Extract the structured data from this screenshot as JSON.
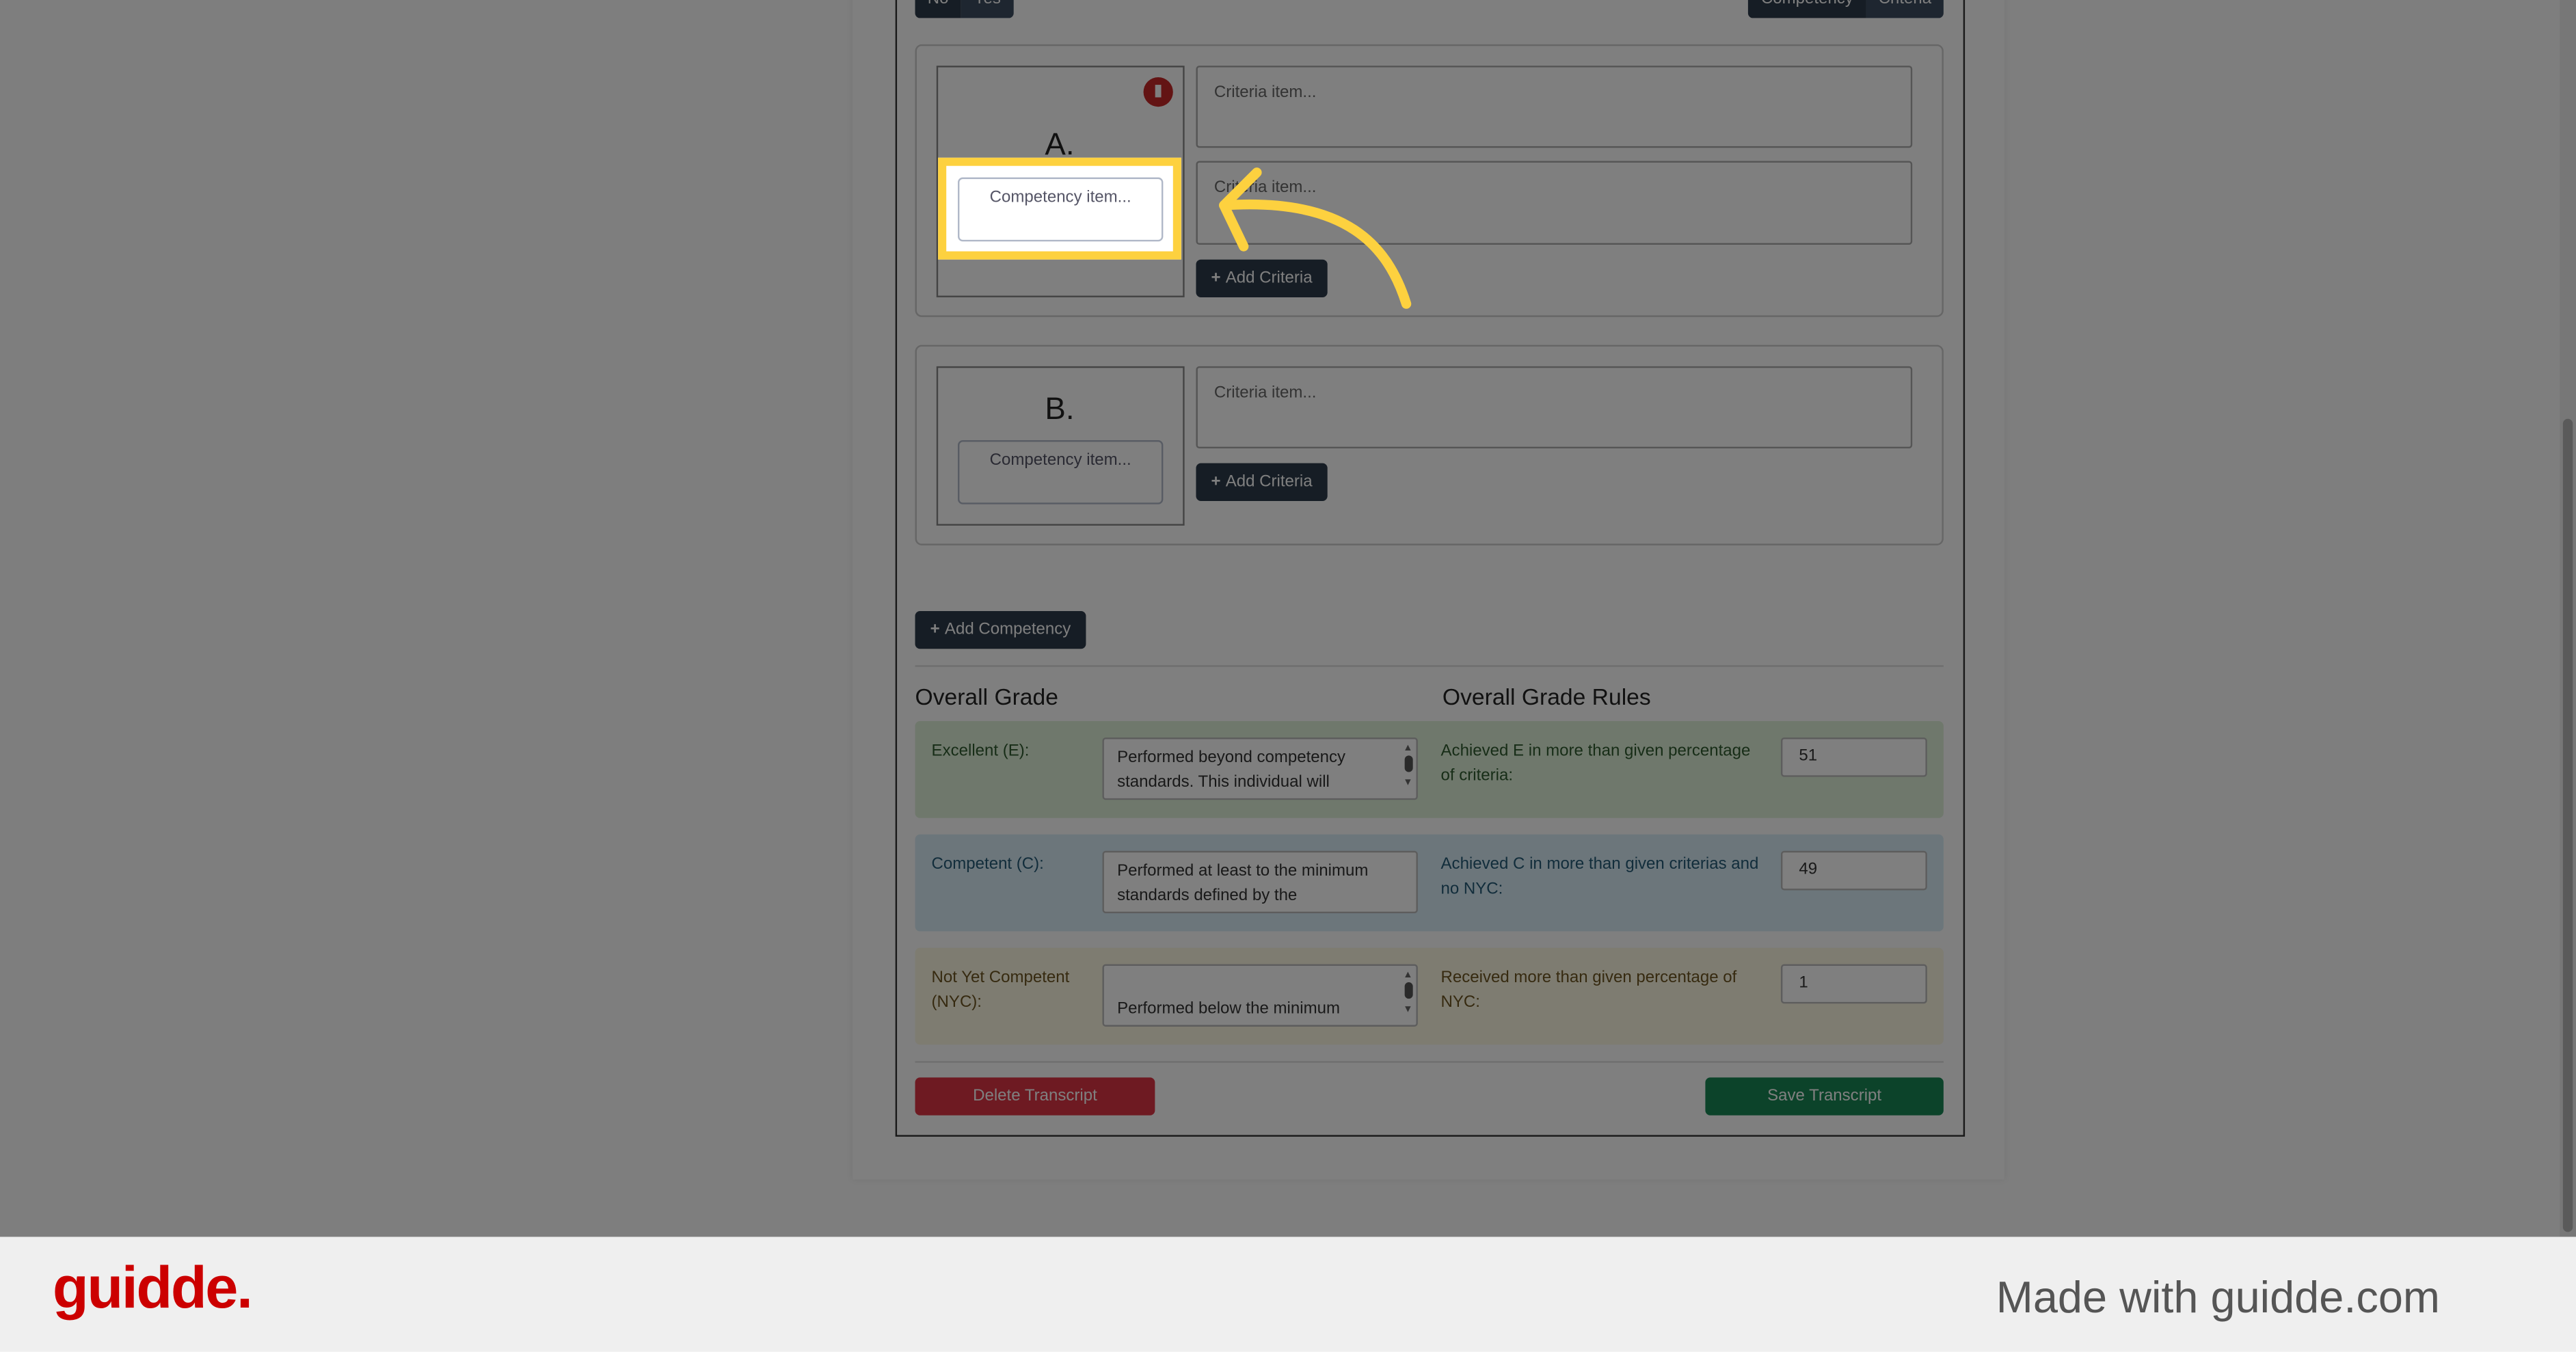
{
  "toggles": {
    "no": "No",
    "yes": "Yes",
    "competency": "Competency",
    "criteria": "Criteria"
  },
  "competencies": [
    {
      "letter": "A.",
      "competency_placeholder": "Competency item...",
      "criteria": [
        "Criteria item...",
        "Criteria item..."
      ],
      "add_criteria": "Add Criteria"
    },
    {
      "letter": "B.",
      "competency_placeholder": "Competency item...",
      "criteria": [
        "Criteria item..."
      ],
      "add_criteria": "Add Criteria"
    }
  ],
  "add_competency": "Add Competency",
  "overall_grade": {
    "title": "Overall Grade",
    "rules_title": "Overall Grade Rules",
    "rows": [
      {
        "label": "Excellent (E):",
        "description": "Performed beyond competency standards. This individual will receive",
        "rule": "Achieved E in more than given percentage of criteria:",
        "value": "51",
        "color": "#dff0d8",
        "text_color": "#3c763d"
      },
      {
        "label": "Competent (C):",
        "description": "Performed at least to the minimum standards defined by the competencies",
        "rule": "Achieved C in more than given criterias and no NYC:",
        "value": "49",
        "color": "#d9edf7",
        "text_color": "#31708f"
      },
      {
        "label": "Not Yet Competent (NYC):",
        "description": "Performed below the minimum",
        "rule": "Received more than given percentage of NYC:",
        "value": "1",
        "color": "#fcf8e3",
        "text_color": "#8a6d3b"
      }
    ]
  },
  "actions": {
    "delete": "Delete Transcript",
    "save": "Save Transcript",
    "delete_color": "#dc3545",
    "save_color": "#198754"
  },
  "highlight_color": "#fdd13f",
  "footer": {
    "logo": "guidde.",
    "tagline": "Made with guidde.com",
    "logo_color": "#cc0000"
  }
}
